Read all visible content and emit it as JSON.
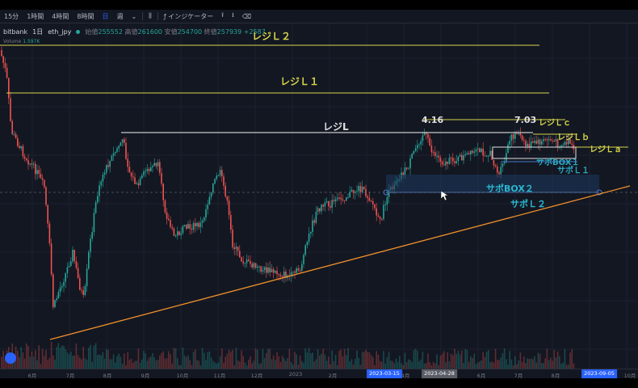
{
  "toolbar": {
    "items": [
      "15分",
      "1時間",
      "4時間",
      "8時間",
      "日",
      "週"
    ],
    "indicator_label": "インジケーター"
  },
  "symbol": {
    "exchange": "bitbank",
    "interval": "1日",
    "pair": "eth_jpy",
    "open_label": "始値",
    "open": "255552",
    "high_label": "高値",
    "high": "261600",
    "low_label": "安値",
    "low": "254700",
    "close_label": "終値",
    "close": "257939",
    "change": "+2587"
  },
  "volume": {
    "label": "Volume",
    "value": "1.597K"
  },
  "annotations": {
    "resist2": "レジＬ２",
    "resist1": "レジＬ１",
    "resist": "レジL",
    "price_416": "4.16",
    "price_703": "7.03",
    "resist_c": "レジＬｃ",
    "resist_b": "レジＬｂ",
    "resist_a": "レジＬａ",
    "support_box1": "サポBOX１",
    "support_l1": "サポＬ１",
    "support_box2": "サポBOX２",
    "support_l2": "サポＬ２"
  },
  "axis": {
    "months": [
      "6月",
      "7月",
      "8月",
      "9月",
      "10月",
      "11月",
      "12月",
      "2023",
      "2月",
      "4月",
      "6月",
      "7月",
      "8月",
      "10月"
    ],
    "highlighted": [
      "2023-03-15",
      "2023-04-28",
      "2023-09-05"
    ]
  },
  "colors": {
    "background": "#131722",
    "up": "#26a69a",
    "down": "#ef5350",
    "resistance_line": "#d4d44a",
    "resistance_main": "#c8c8c8",
    "support_text": "#26b8c8",
    "support_box": "#1e3a5f",
    "trendline": "#f0902a",
    "highlight": "#2962ff"
  }
}
